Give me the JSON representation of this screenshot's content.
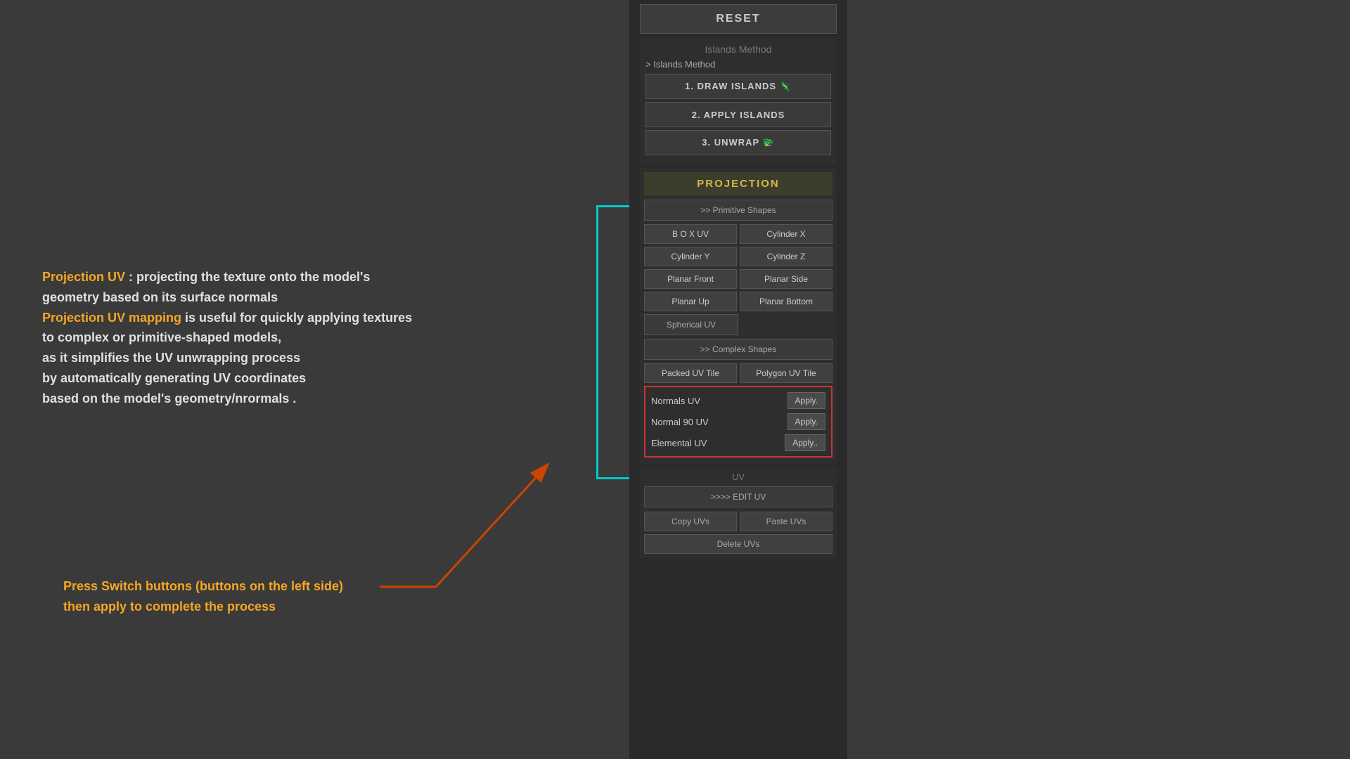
{
  "panel": {
    "reset_label": "RESET",
    "islands_method": {
      "title": "Islands Method",
      "submenu_label": "> Islands Method",
      "draw_islands": "1. DRAW ISLANDS 🦎",
      "apply_islands": "2. APPLY ISLANDS",
      "unwrap": "3. UNWRAP 🐲"
    },
    "projection": {
      "header": "PROJECTION",
      "primitive_shapes": ">> Primitive Shapes",
      "buttons": [
        {
          "left": "B O X UV",
          "right": "Cylinder X"
        },
        {
          "left": "Cylinder Y",
          "right": "Cylinder Z"
        },
        {
          "left": "Planar Front",
          "right": "Planar Side"
        },
        {
          "left": "Planar Up",
          "right": "Planar Bottom"
        }
      ],
      "spherical": "Spherical UV",
      "complex_shapes": ">> Complex Shapes",
      "packed_uv": "Packed UV Tile",
      "polygon_uv": "Polygon UV Tile",
      "normals": {
        "normals_uv": "Normals UV",
        "normal_90": "Normal 90 UV",
        "elemental": "Elemental UV",
        "apply1": "Apply.",
        "apply2": "Apply.",
        "apply3": "Apply.."
      }
    },
    "uv_section": {
      "header": "UV",
      "edit_uv": ">>>> EDIT UV",
      "copy": "Copy UVs",
      "paste": "Paste UVs",
      "delete": "Delete UVs"
    }
  },
  "description": {
    "line1": "Projection UV",
    "line1b": " : projecting the texture onto the model's",
    "line2": "geometry based on its surface normals",
    "line3": "Projection UV mapping",
    "line3b": " is useful for quickly applying textures",
    "line4": "to complex or primitive-shaped models,",
    "line5": "as it simplifies the UV unwrapping process",
    "line6": "by automatically generating UV coordinates",
    "line7": "based on the model's geometry/nrormals ."
  },
  "instruction": {
    "line1": "Press Switch buttons (buttons on the left side)",
    "line2": "then apply to complete the process"
  }
}
